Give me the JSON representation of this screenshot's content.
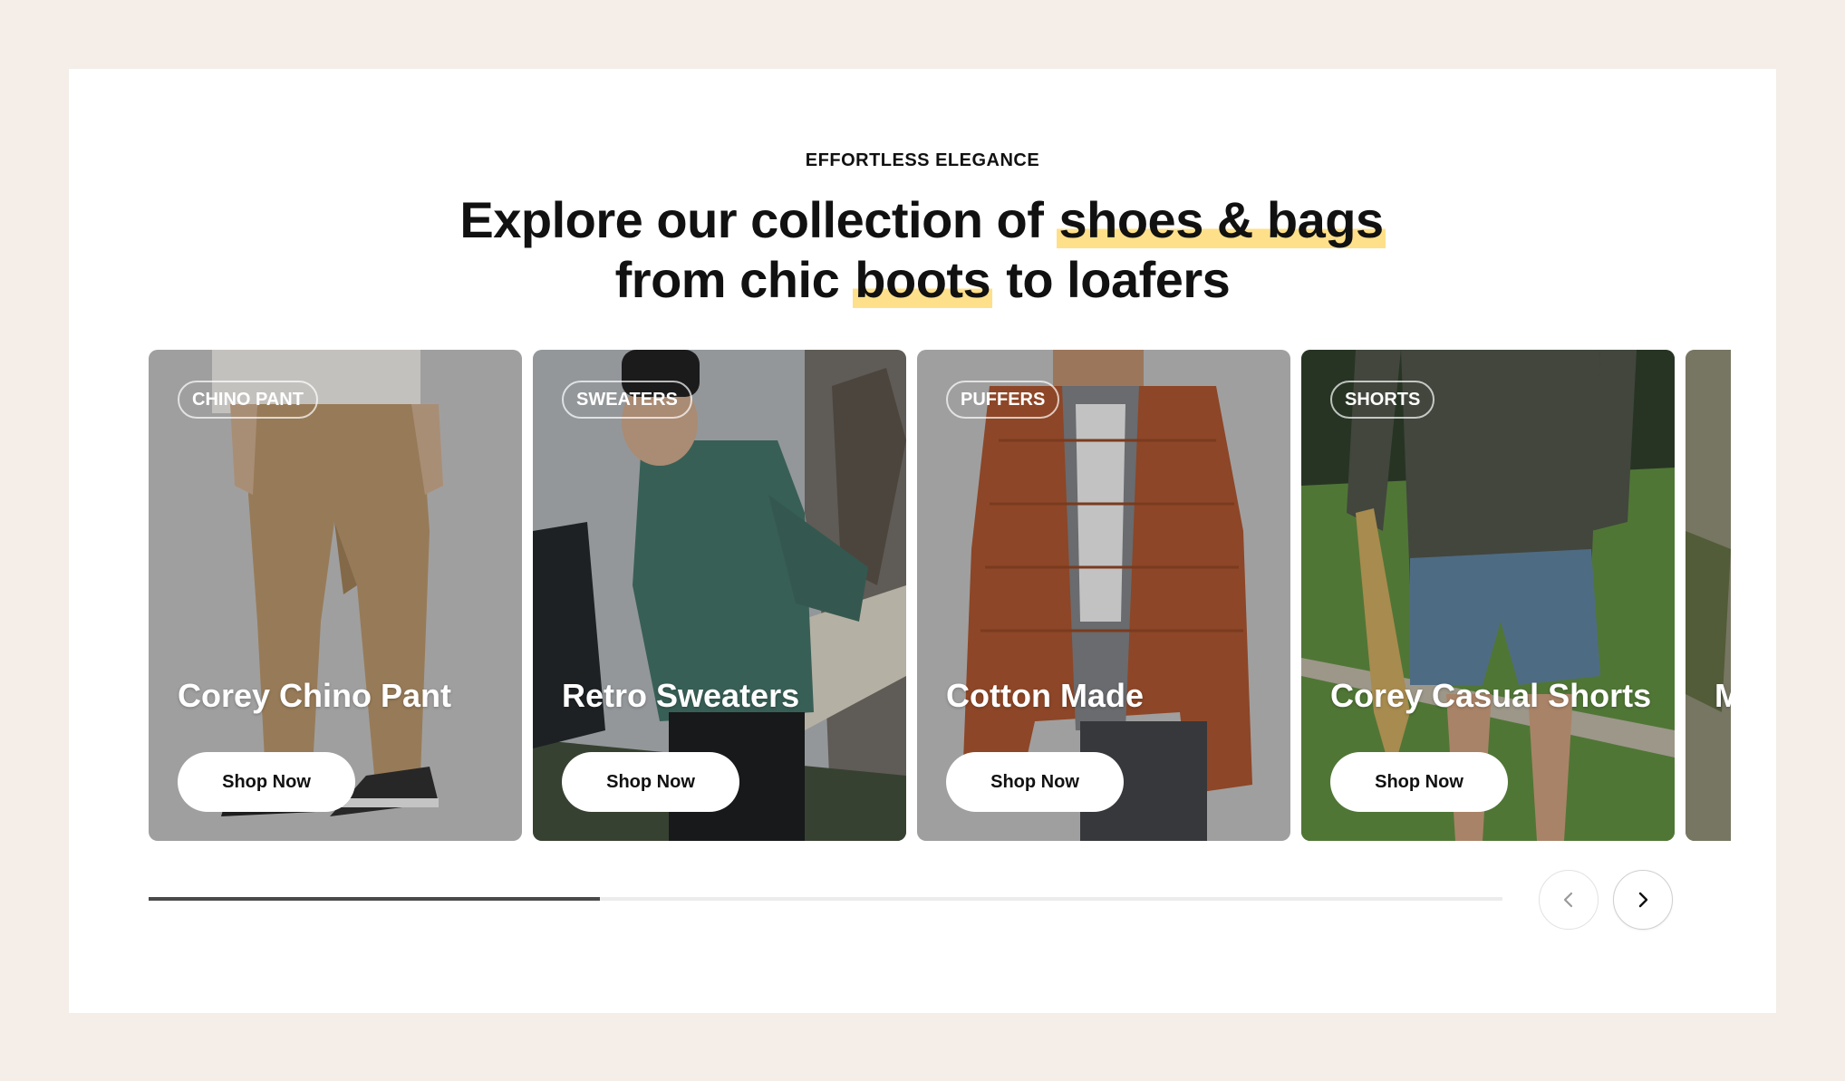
{
  "section": {
    "eyebrow": "EFFORTLESS ELEGANCE",
    "heading": {
      "line1_part1": "Explore our collection of ",
      "line1_highlight": "shoes & bags",
      "line2_part1": "from chic ",
      "line2_highlight": "boots",
      "line2_part2": " to loafers"
    },
    "highlight_color": "#ffe08a"
  },
  "cards": [
    {
      "tag": "CHINO PANT",
      "title": "Corey Chino Pant",
      "button": "Shop Now"
    },
    {
      "tag": "SWEATERS",
      "title": "Retro Sweaters",
      "button": "Shop Now"
    },
    {
      "tag": "PUFFERS",
      "title": "Cotton Made",
      "button": "Shop Now"
    },
    {
      "tag": "SHORTS",
      "title": "Corey Casual Shorts",
      "button": "Shop Now"
    },
    {
      "tag": "",
      "title": "M C",
      "button": ""
    }
  ],
  "carousel": {
    "progress_fraction": 0.333,
    "prev_icon": "chevron-left-icon",
    "next_icon": "chevron-right-icon"
  },
  "colors": {
    "page_background": "#f4ede8",
    "panel_background": "#ffffff",
    "progress_track": "#ececec",
    "progress_fill": "#4a4a4a"
  }
}
